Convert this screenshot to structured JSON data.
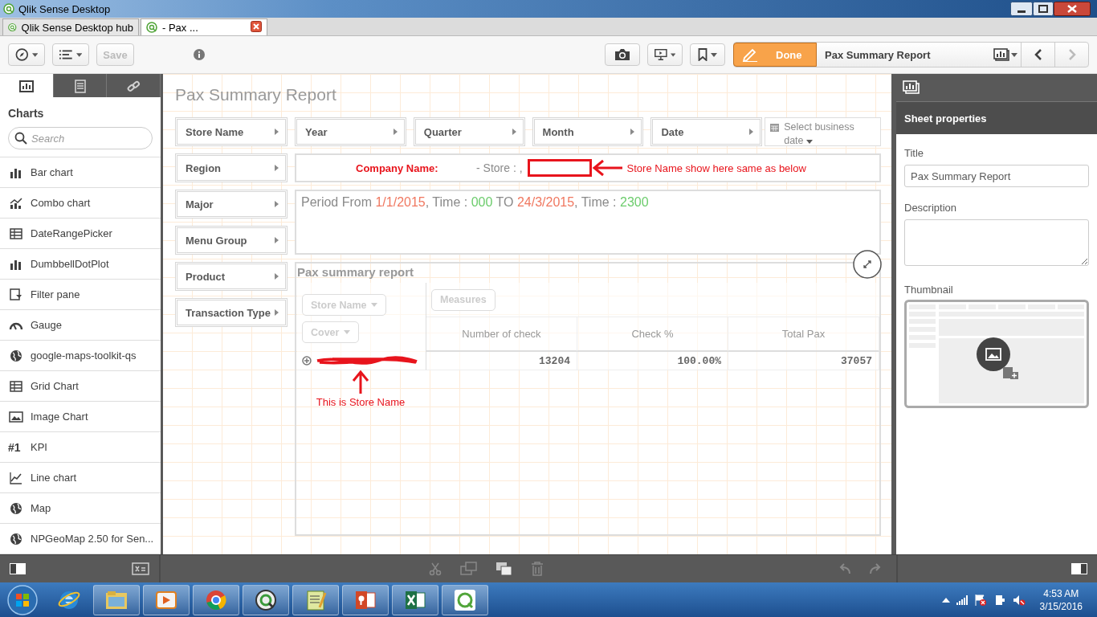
{
  "window": {
    "title": "Qlik Sense Desktop"
  },
  "browser_tabs": [
    {
      "label": "Qlik Sense Desktop hub",
      "selected": false
    },
    {
      "label": "- Pax ...",
      "selected": true
    }
  ],
  "toolbar": {
    "save": {
      "label": "Save",
      "disabled": true
    },
    "done": "Done",
    "sheet_title": "Pax Summary Report",
    "nav": [
      {
        "kind": "prev",
        "disabled": false
      },
      {
        "kind": "next",
        "disabled": true
      }
    ]
  },
  "assets_panel": {
    "tabs": [
      {
        "kind": "charts",
        "selected": true
      },
      {
        "kind": "master",
        "selected": false
      },
      {
        "kind": "fields",
        "selected": false
      }
    ],
    "heading": "Charts",
    "search": {
      "placeholder": "Search"
    },
    "items": [
      {
        "label": "Bar chart",
        "kind": "bar"
      },
      {
        "label": "Combo chart",
        "kind": "combo"
      },
      {
        "label": "DateRangePicker",
        "kind": "table"
      },
      {
        "label": "DumbbellDotPlot",
        "kind": "bar"
      },
      {
        "label": "Filter pane",
        "kind": "filter"
      },
      {
        "label": "Gauge",
        "kind": "gauge"
      },
      {
        "label": "google-maps-toolkit-qs",
        "kind": "globe"
      },
      {
        "label": "Grid Chart",
        "kind": "table"
      },
      {
        "label": "Image Chart",
        "kind": "image"
      },
      {
        "label": "KPI",
        "kind": "kpi",
        "symbol": "#1"
      },
      {
        "label": "Line chart",
        "kind": "line"
      },
      {
        "label": "Map",
        "kind": "globe"
      },
      {
        "label": "NPGeoMap 2.50 for Sen...",
        "kind": "globe"
      }
    ]
  },
  "sheet": {
    "title": "Pax Summary Report",
    "top_filters": [
      {
        "label": "Store Name",
        "kind": "filter"
      },
      {
        "label": "Year",
        "kind": "filter"
      },
      {
        "label": "Quarter",
        "kind": "filter"
      },
      {
        "label": "Month",
        "kind": "filter"
      },
      {
        "label": "Date",
        "kind": "filter"
      },
      {
        "label": "Select business date",
        "kind": "date"
      }
    ],
    "side_filters": [
      {
        "label": "Region",
        "kind": "filter"
      },
      {
        "label": "Major",
        "kind": "filter"
      },
      {
        "label": "Menu Group",
        "kind": "filter"
      },
      {
        "label": "Product",
        "kind": "filter"
      },
      {
        "label": "Transaction Type",
        "kind": "filter"
      }
    ],
    "company_line": {
      "label": "Company Name:",
      "store": "- Store : ,",
      "note": "Store Name show here same as below"
    },
    "period": [
      {
        "text": "Period From ",
        "kind": "plain"
      },
      {
        "text": "1/1/2015",
        "kind": "date"
      },
      {
        "text": ", Time : ",
        "kind": "plain"
      },
      {
        "text": "000",
        "kind": "time"
      },
      {
        "text": " TO ",
        "kind": "plain"
      },
      {
        "text": "24/3/2015",
        "kind": "date"
      },
      {
        "text": ", Time : ",
        "kind": "plain"
      },
      {
        "text": "2300",
        "kind": "time"
      }
    ],
    "table": {
      "title": "Pax summary report",
      "row_dimensions": [
        "Store Name",
        "Cover"
      ],
      "measures_label": "Measures",
      "columns": [
        "Number of check",
        "Check %",
        "Total Pax"
      ],
      "rows": [
        {
          "values": [
            "13204",
            "100.00%",
            "37057"
          ]
        }
      ],
      "note": "This is Store Name"
    }
  },
  "properties": {
    "header": "Sheet properties",
    "title_label": "Title",
    "title_value": "Pax Summary Report",
    "description_label": "Description",
    "thumbnail_label": "Thumbnail"
  },
  "taskbar": {
    "apps": [
      {
        "kind": "ie"
      },
      {
        "kind": "explorer"
      },
      {
        "kind": "media"
      },
      {
        "kind": "chrome"
      },
      {
        "kind": "qlikview"
      },
      {
        "kind": "notepad"
      },
      {
        "kind": "powerpoint"
      },
      {
        "kind": "excel"
      },
      {
        "kind": "qliksense"
      }
    ],
    "time": "4:53 AM",
    "date": "3/15/2016"
  }
}
